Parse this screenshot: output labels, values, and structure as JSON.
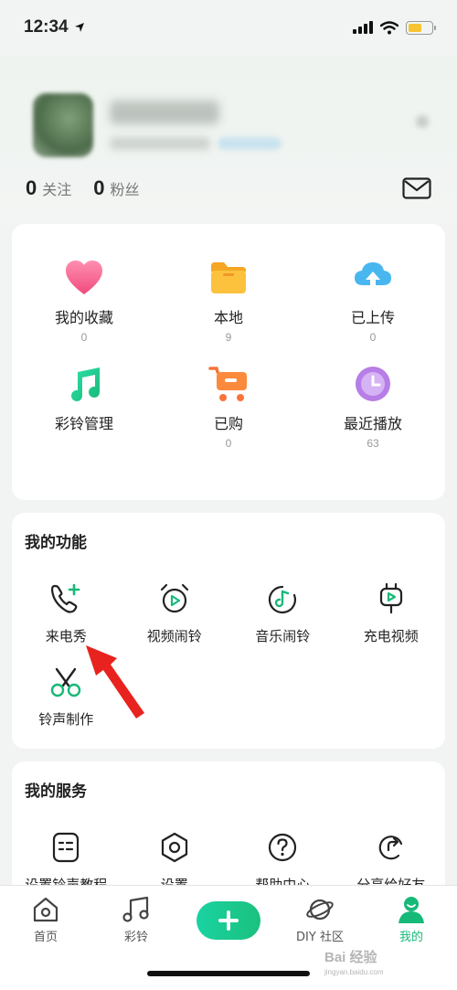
{
  "status": {
    "time": "12:34"
  },
  "profile": {
    "follow": {
      "count": "0",
      "label": "关注"
    },
    "fans": {
      "count": "0",
      "label": "粉丝"
    }
  },
  "library": [
    {
      "label": "我的收藏",
      "count": "0",
      "icon": "heart-icon"
    },
    {
      "label": "本地",
      "count": "9",
      "icon": "folder-icon"
    },
    {
      "label": "已上传",
      "count": "0",
      "icon": "cloud-upload-icon"
    },
    {
      "label": "彩铃管理",
      "count": "",
      "icon": "music-note-icon"
    },
    {
      "label": "已购",
      "count": "0",
      "icon": "shopping-cart-icon"
    },
    {
      "label": "最近播放",
      "count": "63",
      "icon": "clock-icon"
    }
  ],
  "functions": {
    "title": "我的功能",
    "items": [
      {
        "label": "来电秀",
        "icon": "phone-plus-icon"
      },
      {
        "label": "视频闹铃",
        "icon": "video-alarm-icon"
      },
      {
        "label": "音乐闹铃",
        "icon": "music-alarm-icon"
      },
      {
        "label": "充电视频",
        "icon": "charging-video-icon"
      },
      {
        "label": "铃声制作",
        "icon": "scissors-icon"
      }
    ]
  },
  "services": {
    "title": "我的服务",
    "items": [
      {
        "label": "设置铃声教程",
        "icon": "tutorial-icon"
      },
      {
        "label": "设置",
        "icon": "settings-icon"
      },
      {
        "label": "帮助中心",
        "icon": "help-icon"
      },
      {
        "label": "分享给好友",
        "icon": "share-icon"
      }
    ]
  },
  "tabs": [
    {
      "label": "首页",
      "icon": "home-icon"
    },
    {
      "label": "彩铃",
      "icon": "music-icon"
    },
    {
      "label": "DIY 社区",
      "icon": "planet-icon"
    },
    {
      "label": "我的",
      "icon": "user-icon",
      "active": true
    }
  ],
  "watermark": {
    "text": "Bai 经验",
    "sub": "jingyan.baidu.com"
  },
  "colors": {
    "accent": "#17b978",
    "arrow": "#e8231f",
    "heart": "#f05b8a",
    "folder": "#f7b733",
    "cloud": "#2fa6e6",
    "purple": "#a86bdc",
    "cart": "#f7743a"
  }
}
